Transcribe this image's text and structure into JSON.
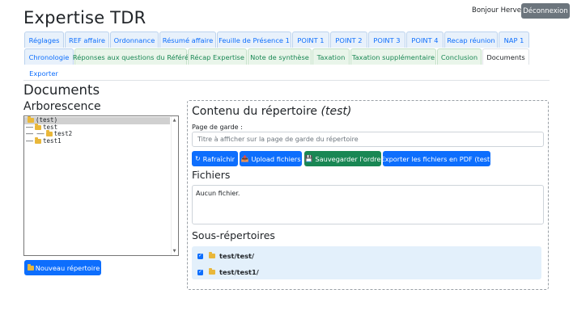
{
  "header": {
    "title": "Expertise TDR",
    "greeting": "Bonjour Herve !",
    "logout_label": "Déconnexion"
  },
  "tabs_row1": [
    {
      "label": "Réglages"
    },
    {
      "label": "REF affaire"
    },
    {
      "label": "Ordonnance"
    },
    {
      "label": "Résumé affaire"
    },
    {
      "label": "Feuille de Présence 1"
    },
    {
      "label": "POINT 1"
    },
    {
      "label": "POINT 2"
    },
    {
      "label": "POINT 3"
    },
    {
      "label": "POINT 4"
    },
    {
      "label": "Recap réunion"
    },
    {
      "label": "NAP 1"
    }
  ],
  "tabs_row2": [
    {
      "label": "Chronologie"
    },
    {
      "label": "Réponses aux questions du Référé"
    },
    {
      "label": "Récap Expertise"
    },
    {
      "label": "Note de synthèse"
    },
    {
      "label": "Taxation"
    },
    {
      "label": "Taxation supplémentaire"
    },
    {
      "label": "Conclusion"
    },
    {
      "label": "Documents"
    }
  ],
  "tabs_row3": [
    {
      "label": "Exporter"
    }
  ],
  "page": {
    "heading": "Documents",
    "tree_heading": "Arborescence",
    "tree_items": [
      {
        "prefix": "",
        "label": "(test)"
      },
      {
        "prefix": "——",
        "label": "test"
      },
      {
        "prefix": "—— ——",
        "label": "test2"
      },
      {
        "prefix": "——",
        "label": "test1"
      }
    ],
    "new_folder_label": "Nouveau répertoire"
  },
  "panel": {
    "title_prefix": "Contenu du répertoire",
    "title_dir": "(test)",
    "garde_label": "Page de garde :",
    "garde_placeholder": "Titre à afficher sur la page de garde du répertoire",
    "buttons": {
      "refresh": "Rafraîchir",
      "upload": "Upload fichiers",
      "save_order": "Sauvegarder l'ordre",
      "export_pdf": "Exporter les fichiers en PDF (test)"
    },
    "files_heading": "Fichiers",
    "no_files": "Aucun fichier.",
    "subdirs_heading": "Sous-répertoires",
    "subdirs": [
      {
        "label": "test/test/"
      },
      {
        "label": "test/test1/"
      }
    ]
  },
  "colors": {
    "primary": "#0d6efd",
    "success": "#198754",
    "secondary": "#6c757d",
    "folder": "#e9b73a"
  }
}
